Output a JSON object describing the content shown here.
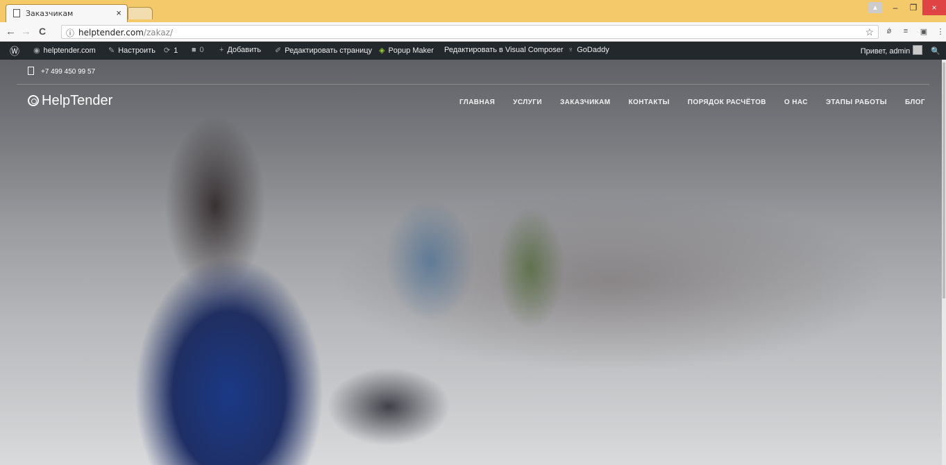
{
  "browser": {
    "tab_title": "Заказчикам",
    "tab_close": "×",
    "window": {
      "minimize": "–",
      "restore": "❐",
      "close": "×"
    },
    "url_host": "helptender.com",
    "url_path": "/zakaz/",
    "info": "ⓘ",
    "star": "☆",
    "nav": {
      "back": "←",
      "forward": "→",
      "reload": "C"
    },
    "extensions": [
      "ǿ",
      "≡",
      "▣",
      "⋮"
    ]
  },
  "adminbar": {
    "wp_icon": "Ⓦ",
    "site_name": "helptender.com",
    "customize": "Настроить",
    "updates_count": "1",
    "comments_count": "0",
    "add_new": "Добавить",
    "edit_page": "Редактировать страницу",
    "popup_maker": "Popup Maker",
    "visual_composer": "Редактировать в Visual Composer",
    "godaddy": "GoDaddy",
    "greeting": "Привет, admin",
    "search_icon": "🔍"
  },
  "site": {
    "phone": "+7 499 450 99 57",
    "logo": "HelpTender",
    "nav": [
      "ГЛАВНАЯ",
      "УСЛУГИ",
      "ЗАКАЗЧИКАМ",
      "КОНТАКТЫ",
      "ПОРЯДОК РАСЧЁТОВ",
      "О НАС",
      "ЭТАПЫ РАБОТЫ",
      "БЛОГ"
    ]
  }
}
